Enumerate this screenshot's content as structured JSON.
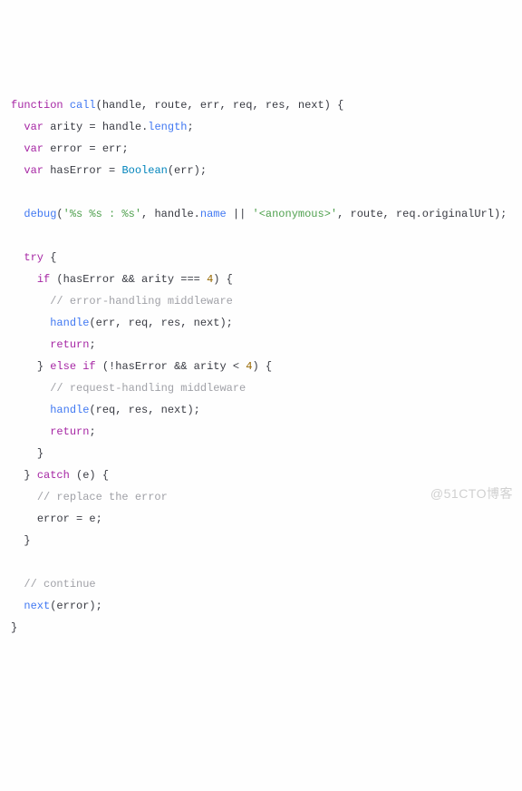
{
  "watermark": "@51CTO博客",
  "code": {
    "l1": {
      "kw1": "function",
      "fn": "call",
      "params": "(handle, route, err, req, res, next) {"
    },
    "l2": {
      "kw": "var",
      "id": "arity",
      "eq": " = ",
      "obj": "handle",
      "dot": ".",
      "prop": "length",
      "end": ";"
    },
    "l3": {
      "kw": "var",
      "id": "error",
      "eq": " = ",
      "rhs": "err;"
    },
    "l4": {
      "kw": "var",
      "id": "hasError",
      "eq": " = ",
      "bool": "Boolean",
      "rest": "(err);"
    },
    "l6": {
      "fn": "debug",
      "open": "(",
      "str1": "'%s %s : %s'",
      "c1": ", ",
      "obj": "handle",
      "dot": ".",
      "prop": "name",
      "or": " || ",
      "str2": "'<anonymous>'",
      "c2": ", route, req.originalUrl);"
    },
    "l8": {
      "kw": "try",
      "brace": " {"
    },
    "l9": {
      "kw": "if",
      "open": " (hasError ",
      "op": "&&",
      "mid": " arity ",
      "eq": "===",
      "sp": " ",
      "num": "4",
      "close": ") {"
    },
    "l10": {
      "cmt": "// error-handling middleware"
    },
    "l11": {
      "fn": "handle",
      "args": "(err, req, res, next);"
    },
    "l12": {
      "kw": "return",
      "end": ";"
    },
    "l13": {
      "close": "} ",
      "kw": "else if",
      "open": " (!hasError ",
      "op": "&&",
      "mid": " arity < ",
      "num": "4",
      "close2": ") {"
    },
    "l14": {
      "cmt": "// request-handling middleware"
    },
    "l15": {
      "fn": "handle",
      "args": "(req, res, next);"
    },
    "l16": {
      "kw": "return",
      "end": ";"
    },
    "l17": {
      "brace": "}"
    },
    "l18": {
      "close": "} ",
      "kw": "catch",
      "rest": " (e) {"
    },
    "l19": {
      "cmt": "// replace the error"
    },
    "l20": {
      "stmt": "error = e;"
    },
    "l21": {
      "brace": "}"
    },
    "l23": {
      "cmt": "// continue"
    },
    "l24": {
      "fn": "next",
      "args": "(error);"
    },
    "l25": {
      "brace": "}"
    }
  }
}
